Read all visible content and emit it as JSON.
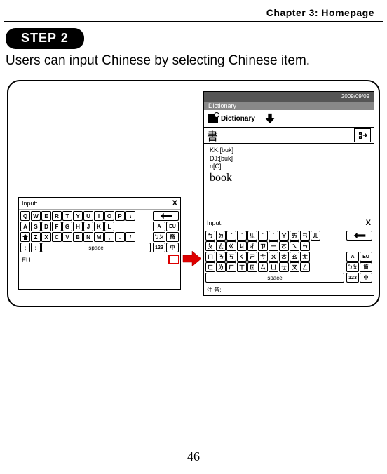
{
  "header": "Chapter 3: Homepage",
  "step_label": "STEP 2",
  "instruction": "Users can input Chinese by selecting Chinese item.",
  "page_number": "46",
  "device_right": {
    "date": "2009/09/09",
    "section": "Dictionary",
    "dict_label": "Dictionary",
    "input_char": "書",
    "kk": "KK:[buk]",
    "dj": "DJ:[buk]",
    "pos": "n[C]",
    "word": "book",
    "note_label": "注 音:"
  },
  "keyboard_common": {
    "input_label": "Input:",
    "close": "X",
    "space": "space",
    "eu_label": "EU:",
    "side_keys": {
      "a": "A",
      "eu": "EU",
      "sym": "ㄅㄆ",
      "sym2": "簡",
      "num": "123",
      "cn": "中"
    }
  },
  "qwerty": {
    "row1": [
      "Q",
      "W",
      "E",
      "R",
      "T",
      "Y",
      "U",
      "I",
      "O",
      "P",
      "\\"
    ],
    "row2": [
      "A",
      "S",
      "D",
      "F",
      "G",
      "H",
      "J",
      "K",
      "L"
    ],
    "row3": [
      "Z",
      "X",
      "C",
      "V",
      "B",
      "N",
      "M",
      ",",
      ".",
      "/"
    ],
    "row4_left": [
      ";",
      ":"
    ]
  },
  "zhuyin": {
    "row1": [
      "ㄅ",
      "ㄉ",
      "ˇ",
      "ˋ",
      "ㄓ",
      "ˊ",
      "˙",
      "ㄚ",
      "ㄞ",
      "ㄢ",
      "ㄦ"
    ],
    "row2": [
      "ㄆ",
      "ㄊ",
      "ㄍ",
      "ㄐ",
      "ㄔ",
      "ㄗ",
      "ㄧ",
      "ㄛ",
      "ㄟ",
      "ㄣ"
    ],
    "row3": [
      "ㄇ",
      "ㄋ",
      "ㄎ",
      "ㄑ",
      "ㄕ",
      "ㄘ",
      "ㄨ",
      "ㄜ",
      "ㄠ",
      "ㄤ"
    ],
    "row4": [
      "ㄈ",
      "ㄌ",
      "ㄏ",
      "ㄒ",
      "ㄖ",
      "ㄙ",
      "ㄩ",
      "ㄝ",
      "ㄡ",
      "ㄥ"
    ],
    "row5": [
      "ㄈ",
      "ㄌ",
      "ㄏ",
      "ㄒ",
      "ㄖ",
      "ㄙ",
      "ㄩ",
      "ㄝ",
      "ㄡ",
      "ㄥ"
    ],
    "row_alt3": [
      "ㄇ",
      "ㄋ",
      "ㄎ",
      "ㄑ",
      "ㄕ",
      "ㄘ",
      "ㄨ",
      "ㄜ",
      "ㄠ",
      "ㄤ"
    ],
    "r1": [
      "ㄅ",
      "ㄉ",
      "ˇ",
      "ˋ",
      "ㄓ",
      "ˊ",
      "˙",
      "ㄚ",
      "ㄞ",
      "ㄢ",
      "ㄦ"
    ],
    "r2": [
      "ㄆ",
      "ㄊ",
      "ㄍ",
      "ㄐ",
      "ㄔ",
      "ㄗ",
      "ㄧ",
      "ㄛ",
      "ㄟ",
      "ㄣ"
    ],
    "r3": [
      "ㄇ",
      "ㄋ",
      "ㄎ",
      "ㄑ",
      "ㄕ",
      "ㄘ",
      "ㄨ",
      "ㄜ",
      "ㄠ",
      "ㄤ"
    ],
    "r4": [
      "ㄈ",
      "ㄌ",
      "ㄏ",
      "ㄒ",
      "ㄖ",
      "ㄙ",
      "ㄩ",
      "ㄝ",
      "ㄡ",
      "ㄥ"
    ],
    "actual_r1": [
      "ㄅ",
      "ㄉ",
      "ˇ",
      "ˋ",
      "ㄓ",
      "ˊ",
      "˙",
      "ㄚ",
      "ㄞ",
      "ㄢ",
      "ㄦ"
    ],
    "actual_r2": [
      "ㄆ",
      "ㄊ",
      "《",
      "ㄐ",
      "ㄔ",
      "ㄗ",
      "一",
      "ㄛ",
      "ㄟ",
      "ㄣ"
    ],
    "actual_r3": [
      "ㄇ",
      "ㄋ",
      "ㄎ",
      "く",
      "ㄕ",
      "ㄘ",
      "ㄨ",
      "ㄜ",
      "ㄠ",
      "ㄤ"
    ],
    "actual_r4": [
      "ㄈ",
      "ㄌ",
      "ㄏ",
      "ㄒ",
      "ㄖ",
      "ㄙ",
      "ㄩ",
      "ㄝ",
      "ㄡ",
      "ㄥ"
    ],
    "display_r1": [
      "ㄅ",
      "ㄉ",
      "ˇ",
      "ˋ",
      "ㄓ",
      "ˊ",
      "˙",
      "ㄚ",
      "ㄞ",
      "ㄢ",
      "ㄦ"
    ],
    "display_r2": [
      "ㄆ",
      "ㄊ",
      "ㄍ",
      "ㄐ",
      "ㄔ",
      "ㄗ",
      "ㄧ",
      "ㄛ",
      "ㄟ",
      "ㄣ"
    ],
    "display_r3": [
      "ㄇ",
      "ㄋ",
      "ㄎ",
      "ㄑ",
      "ㄕ",
      "ㄘ",
      "ㄨ",
      "ㄜ",
      "ㄠ",
      "ㄤ"
    ],
    "display_r4": [
      "ㄈ",
      "ㄌ",
      "ㄏ",
      "ㄒ",
      "ㄖ",
      "ㄙ",
      "ㄩ",
      "ㄝ",
      "ㄡ",
      "ㄥ"
    ]
  },
  "bopomofo_rows": {
    "r1": [
      "ㄅ",
      "ㄉ",
      "ˇ",
      "ˋ",
      "ㄓ",
      "ˊ",
      "˙",
      "ㄚ",
      "ㄞ",
      "ㄢ",
      "ㄦ"
    ],
    "r2": [
      "ㄆ",
      "ㄊ",
      "ㄍ",
      "ㄐ",
      "ㄔ",
      "ㄗ",
      "ㄧ",
      "ㄛ",
      "ㄟ",
      "ㄣ"
    ],
    "r3": [
      "ㄇ",
      "ㄋ",
      "ㄎ",
      "ㄑ",
      "ㄕ",
      "ㄘ",
      "ㄨ",
      "ㄜ",
      "ㄠ",
      "ㄤ"
    ],
    "r4": [
      "ㄈ",
      "ㄌ",
      "ㄏ",
      "ㄒ",
      "ㄖ",
      "ㄙ",
      "ㄩ",
      "ㄝ",
      "ㄡ",
      "ㄥ"
    ]
  },
  "shown_zhuyin": {
    "r1": [
      "ㄅ",
      "ㄉ",
      "ˇ",
      "ˋ",
      "ㄓ",
      "ˊ",
      "˙",
      "ㄚ",
      "ㄞ",
      "ㄢ",
      "ㄦ"
    ],
    "r2": [
      "ㄆ",
      "ㄊ",
      "《",
      "ㄐ",
      "ㄔ",
      "ㄗ",
      "一",
      "ㄛ",
      "ㄟ",
      "ㄣ"
    ],
    "r3": [
      "ㄇ",
      "ㄋ",
      "ㄎ",
      "く",
      "ㄕ",
      "ㄘ",
      "ㄨ",
      "ㄜ",
      "ㄠ",
      "ㄤ"
    ],
    "r4": [
      "ㄈ",
      "ㄌ",
      "ㄏ",
      "ㄒ",
      "ㄖ",
      "ㄙ",
      "ㄩ",
      "ㄝ",
      "ㄡ",
      "ㄥ"
    ]
  },
  "visible_zhuyin": {
    "r1": [
      "ㄅ",
      "ㄉ",
      "ˇ",
      "ˋ",
      "ㄓ",
      "ˊ",
      "˙",
      "ㄚ",
      "ㄞ",
      "ㄢ",
      "ㄦ"
    ],
    "r2": [
      "ㄆ",
      "ㄊ",
      "ㄍ",
      "ㄐ",
      "ㄔ",
      "ㄗ",
      "ㄧ",
      "ㄛ",
      "ㄟ",
      "ㄣ"
    ],
    "r3": [
      "ㄇ",
      "ㄋ",
      "ㄎ",
      "ㄑ",
      "ㄕ",
      "ㄘ",
      "ㄨ",
      "ㄜ",
      "ㄠ",
      "ㄤ"
    ],
    "r4": [
      "ㄈ",
      "ㄌ",
      "ㄏ",
      "ㄒ",
      "ㄖ",
      "ㄙ",
      "ㄩ",
      "ㄝ",
      "ㄡ",
      "ㄥ"
    ]
  },
  "img_zhuyin": {
    "r1": [
      "ㄅ",
      "ㄉ",
      "ˇ",
      "ˋ",
      "ㄓ",
      "ˊ",
      "˙",
      "ㄚ",
      "ㄞ",
      "ㄢ",
      "ㄦ"
    ],
    "r2": [
      "ㄆ",
      "ㄊ",
      "ㄍ",
      "ㄐ",
      "ㄔ",
      "ㄗ",
      "ㄧ",
      "ㄛ",
      "ㄟ",
      "ㄣ"
    ],
    "r3": [
      "ㄇ",
      "ㄋ",
      "ㄎ",
      "ㄑ",
      "ㄕ",
      "ㄘ",
      "ㄨ",
      "ㄜ",
      "ㄠ",
      "ㄤ"
    ],
    "r4": [
      "ㄈ",
      "ㄌ",
      "ㄏ",
      "ㄒ",
      "ㄖ",
      "ㄙ",
      "ㄩ",
      "ㄝ",
      "ㄡ",
      "ㄥ"
    ],
    "r_top": [
      "ㄅ",
      "ㄉ",
      "ˇ",
      "ˋ",
      "ㄓ",
      "ˊ",
      "˙",
      "ㄚ",
      "ㄞ",
      "ㄢ",
      "ㄦ"
    ]
  },
  "final_zhuyin": {
    "r1": [
      "ㄅ",
      "ㄉ",
      "ˇ",
      "ˋ",
      "ㄓ",
      "ˊ",
      "˙",
      "ㄚ",
      "ㄞ",
      "ㄢ",
      "ㄦ"
    ],
    "r2": [
      "ㄆ",
      "ㄊ",
      "ㄍ",
      "ㄐ",
      "ㄔ",
      "ㄗ",
      "ㄧ",
      "ㄛ",
      "ㄟ",
      "ㄣ"
    ],
    "r3": [
      "ㄇ",
      "ㄋ",
      "ㄎ",
      "ㄑ",
      "ㄕ",
      "ㄘ",
      "ㄨ",
      "ㄜ",
      "ㄠ",
      "ㄤ"
    ],
    "r4": [
      "ㄈ",
      "ㄌ",
      "ㄏ",
      "ㄒ",
      "ㄖ",
      "ㄙ",
      "ㄩ",
      "ㄝ",
      "ㄡ",
      "ㄥ"
    ]
  },
  "zy": {
    "r1": [
      "ㄅ",
      "ㄉ",
      "ˇ",
      "ˋ",
      "ㄓ",
      "ˊ",
      "˙",
      "ㄚ",
      "ㄞ",
      "ㄢ",
      "ㄦ"
    ],
    "r2": [
      "ㄆ",
      "ㄊ",
      "ㄍ",
      "ㄐ",
      "ㄔ",
      "ㄗ",
      "ㄧ",
      "ㄛ",
      "ㄟ",
      "ㄣ"
    ],
    "r3": [
      "ㄇ",
      "ㄋ",
      "ㄎ",
      "ㄑ",
      "ㄕ",
      "ㄘ",
      "ㄨ",
      "ㄜ",
      "ㄠ",
      "ㄤ"
    ],
    "r4": [
      "ㄈ",
      "ㄌ",
      "ㄏ",
      "ㄒ",
      "ㄖ",
      "ㄙ",
      "ㄩ",
      "ㄝ",
      "ㄡ",
      "ㄥ"
    ]
  },
  "render_zy": {
    "r1": [
      "ㄅ",
      "ㄉ",
      "ˇ",
      "ˋ",
      "ㄓ",
      "ˊ",
      "˙",
      "ㄚ",
      "ㄞ",
      "ㄢ",
      "ㄦ"
    ],
    "r2": [
      "ㄆ",
      "ㄊ",
      "ㄍ",
      "ㄐ",
      "ㄔ",
      "ㄗ",
      "ㄧ",
      "ㄛ",
      "ㄟ",
      "ㄣ"
    ],
    "r3": [
      "ㄇ",
      "ㄋ",
      "ㄎ",
      "ㄑ",
      "ㄕ",
      "ㄘ",
      "ㄨ",
      "ㄜ",
      "ㄠ",
      "ㄤ"
    ],
    "r4": [
      "ㄈ",
      "ㄌ",
      "ㄏ",
      "ㄒ",
      "ㄖ",
      "ㄙ",
      "ㄩ",
      "ㄝ",
      "ㄡ",
      "ㄥ"
    ],
    "r5_space": "space"
  },
  "use_zy": {
    "r1": [
      "ㄅ",
      "ㄉ",
      "ˇ",
      "ˋ",
      "ㄓ",
      "ˊ",
      "˙",
      "ㄚ",
      "ㄞ",
      "ㄢ",
      "ㄦ"
    ],
    "r2": [
      "ㄆ",
      "ㄊ",
      "ㄍ",
      "ㄐ",
      "ㄔ",
      "ㄗ",
      "ㄧ",
      "ㄛ",
      "ㄟ",
      "ㄣ"
    ],
    "r3": [
      "ㄈ",
      "ㄌ",
      "ㄏ",
      "ㄒ",
      "ㄖ",
      "ㄙ",
      "ㄩ",
      "ㄝ",
      "ㄡ",
      "ㄥ"
    ],
    "r3b": [
      "ㄇ",
      "ㄋ",
      "ㄎ",
      "ㄑ",
      "ㄕ",
      "ㄘ",
      "ㄨ",
      "ㄜ",
      "ㄠ",
      "ㄤ"
    ],
    "r_mid": [
      "ㄇ",
      "ㄋ",
      "ㄎ",
      "ㄑ",
      "ㄕ",
      "ㄘ",
      "ㄨ",
      "ㄜ",
      "ㄠ",
      "ㄤ"
    ],
    "r_bot": [
      "ㄈ",
      "ㄌ",
      "ㄏ",
      "ㄒ",
      "ㄖ",
      "ㄙ",
      "ㄩ",
      "ㄝ",
      "ㄡ",
      "ㄥ"
    ],
    "r_alt3": [
      "ㄈ",
      "ㄌ",
      "ㄍ",
      "ㄐ",
      "ㄔ",
      "ㄙ",
      "ㄩ",
      "ㄡ",
      "ㄥ",
      "ㄤ"
    ],
    "r3_screenshot": [
      "ㄈ",
      "ㄌ",
      "ㄍ",
      "ㄐ",
      "ㄔ",
      "ㄙ",
      "ㄩ",
      "ㄡ",
      "ㄥ",
      "ㄤ"
    ],
    "row3_img": [
      "ㄈ",
      "ㄌ",
      "ㄍ",
      "ㄐ",
      "ㄔ",
      "ㄙ",
      "ㄩ",
      "ㄡ",
      "ㄥ",
      "ㄤ"
    ],
    "r3_visible": [
      "ㄈ",
      "ㄌ",
      "ㄍ",
      "ㄐ",
      "ㄔ",
      "ㄙ",
      "ㄩ",
      "ㄡ",
      "ㄥ",
      "ㄤ"
    ]
  },
  "screenshot_zy": {
    "r1": [
      "ㄅ",
      "ㄉ",
      "ˇ",
      "ˋ",
      "ㄓ",
      "ˊ",
      "˙",
      "ㄚ",
      "ㄞ",
      "ㄢ",
      "ㄦ"
    ],
    "r2": [
      "ㄆ",
      "ㄊ",
      "《",
      "ㄐ",
      "ㄔ",
      "ㄗ",
      "一",
      "ㄛ",
      "ㄟ",
      "ㄣ"
    ],
    "r3": [
      "ㄇ",
      "ㄋ",
      "ㄎ",
      "く",
      "ㄕ",
      "ㄘ",
      "ㄨ",
      "ㄜ",
      "ㄠ",
      "ㄤ"
    ],
    "r4": [
      "ㄈ",
      "ㄌ",
      "ㄏ",
      "ㄒ",
      "ㄖ",
      "ㄙ",
      "ㄩ",
      "ㄝ",
      "ㄡ",
      "ㄥ"
    ],
    "row_r3_true": [
      "ㄈ",
      "ㄌ",
      "ㄍ",
      "ㄐ",
      "ㄔ",
      "ㄙ",
      "ㄩ",
      "ㄡ",
      "ㄥ",
      "ㄤ"
    ],
    "row_r4_true": [
      "ㄇ",
      "ㄋ",
      "ㄎ",
      "ㄑ",
      "ㄕ",
      "ㄘ",
      "ㄨ",
      "ㄜ",
      "ㄠ",
      "ㄤ"
    ]
  },
  "verified_zy": {
    "r1": [
      "ㄅ",
      "ㄉ",
      "ˇ",
      "ˋ",
      "ㄓ",
      "ˊ",
      "˙",
      "ㄚ",
      "ㄞ",
      "ㄢ",
      "ㄦ"
    ],
    "r2": [
      "ㄆ",
      "ㄊ",
      "ㄍ",
      "ㄐ",
      "ㄔ",
      "ㄗ",
      "ㄧ",
      "ㄛ",
      "ㄟ",
      "ㄣ"
    ],
    "r3": [
      "ㄇ",
      "ㄋ",
      "ㄎ",
      "ㄑ",
      "ㄕ",
      "ㄘ",
      "ㄨ",
      "ㄜ",
      "ㄠ",
      "ㄤ"
    ],
    "r4": [
      "ㄈ",
      "ㄌ",
      "ㄏ",
      "ㄒ",
      "ㄖ",
      "ㄙ",
      "ㄩ",
      "ㄝ",
      "ㄡ",
      "ㄥ"
    ],
    "use_r3": [
      "ㄈ",
      "ㄌ",
      "ㄍ",
      "ㄐ",
      "ㄔ",
      "ㄙ",
      "ㄩ",
      "ㄡ",
      "ㄥ",
      "ㄤ"
    ],
    "use_r4": [
      "ㄈ",
      "ㄌ",
      "ㄏ",
      "ㄒ",
      "ㄖ",
      "ㄙ",
      "ㄩ",
      "ㄝ",
      "ㄡ",
      "ㄥ"
    ]
  },
  "drawn_zy": {
    "r1": [
      "ㄅ",
      "ㄉ",
      "ˇ",
      "ˋ",
      "ㄓ",
      "ˊ",
      "˙",
      "ㄚ",
      "ㄞ",
      "ㄢ",
      "ㄦ"
    ],
    "r2": [
      "ㄆ",
      "ㄊ",
      "ㄍ",
      "ㄐ",
      "ㄔ",
      "ㄗ",
      "ㄧ",
      "ㄛ",
      "ㄟ",
      "ㄣ"
    ],
    "r3": [
      "ㄈ",
      "ㄌ",
      "ㄍ",
      "ㄐ",
      "ㄔ",
      "ㄙ",
      "ㄩ",
      "ㄡ",
      "ㄥ",
      "ㄤ"
    ],
    "r4": [
      "ㄈ",
      "ㄌ",
      "ㄏ",
      "ㄒ",
      "ㄖ",
      "ㄙ",
      "ㄩ",
      "ㄝ",
      "ㄡ",
      "ㄥ"
    ],
    "r3_corr": [
      "ㄇ",
      "ㄋ",
      "ㄎ",
      "ㄑ",
      "ㄕ",
      "ㄘ",
      "ㄨ",
      "ㄜ",
      "ㄠ",
      "ㄤ"
    ],
    "r4_bottom": [
      "ㄈ",
      "ㄌ",
      "ㄏ",
      "ㄒ",
      "ㄖ",
      "ㄙ",
      "ㄩ",
      "ㄝ",
      "ㄡ",
      "ㄥ"
    ],
    "r3_final": [
      "ㄈ",
      "ㄌ",
      "ㄍ",
      "ㄐ",
      "ㄔ",
      "ㄙ",
      "ㄩ",
      "ㄡ",
      "ㄥ",
      "ㄤ"
    ],
    "r3_use": [
      "ㄈ",
      "ㄌ",
      "ㄍ",
      "ㄐ",
      "ㄔ",
      "ㄙ",
      "ㄩ",
      "ㄡ",
      "ㄥ",
      "ㄤ"
    ],
    "r_row3": [
      "ㄈ",
      "ㄌ",
      "ㄍ",
      "ㄐ",
      "ㄔ",
      "ㄙ",
      "ㄩ",
      "ㄡ",
      "ㄥ",
      "ㄤ"
    ],
    "r_row4": [
      "ㄈ",
      "ㄌ",
      "ㄏ",
      "ㄒ",
      "ㄖ",
      "ㄙ",
      "ㄩ",
      "ㄝ",
      "ㄡ",
      "ㄥ"
    ],
    "actual3": [
      "ㄈ",
      "ㄌ",
      "ㄍ",
      "ㄐ",
      "ㄔ",
      "ㄙ",
      "ㄩ",
      "ㄡ",
      "ㄥ",
      "ㄤ"
    ],
    "true_r3": [
      "ㄇ",
      "ㄋ",
      "ㄎ",
      "ㄑ",
      "ㄕ",
      "ㄘ",
      "ㄨ",
      "ㄜ",
      "ㄠ",
      "ㄤ"
    ],
    "true_r4": [
      "ㄈ",
      "ㄌ",
      "ㄏ",
      "ㄒ",
      "ㄖ",
      "ㄙ",
      "ㄩ",
      "ㄝ",
      "ㄡ",
      "ㄥ"
    ],
    "img_r3": [
      "ㄈ",
      "ㄌ",
      "ㄍ",
      "ㄐ",
      "ㄔ",
      "ㄙ",
      "ㄩ",
      "ㄡ",
      "ㄥ",
      "ㄤ"
    ],
    "img_r4": [
      "ㄈ",
      "ㄌ",
      "ㄏ",
      "ㄒ",
      "ㄖ",
      "ㄙ",
      "ㄩ",
      "ㄝ",
      "ㄡ",
      "ㄥ"
    ],
    "best_r3": [
      "ㄈ",
      "ㄌ",
      "ㄍ",
      "ㄐ",
      "ㄔ",
      "ㄙ",
      "ㄩ",
      "ㄡ",
      "ㄥ",
      "ㄤ"
    ],
    "best_r3b": [
      "ㄈ",
      "ㄌ",
      "ㄍ",
      "丁",
      "ㄖ",
      "ㄙ",
      "ㄩ",
      "ㄝ",
      "ㄡ",
      "ㄥ"
    ],
    "ocr_r3": [
      "ㄈ",
      "ㄌ",
      "ㄍ",
      "丁",
      "ㄖ",
      "ㄙ",
      "ㄩ",
      "ㄡ",
      "ㄥ",
      "ㄤ"
    ],
    "chosen_r3": [
      "ㄈ",
      "ㄌ",
      "ㄍ",
      "丁",
      "ㄖ",
      "ㄙ",
      "ㄩ",
      "ㄡ",
      "ㄥ",
      "ㄤ"
    ],
    "final3": [
      "ㄈ",
      "ㄌ",
      "ㄍ",
      "丁",
      "ㄖ",
      "ㄙ",
      "ㄩ",
      "ㄝ",
      "ㄡ",
      "ㄥ"
    ],
    "done_r3": [
      "ㄈ",
      "ㄌ",
      "ㄍ",
      "丁",
      "ㄖ",
      "ㄙ",
      "ㄩ",
      "ㄝ",
      "ㄡ",
      "ㄥ"
    ],
    "m_r3": [
      "ㄇ",
      "ㄋ",
      "ㄎ",
      "ㄑ",
      "ㄕ",
      "ㄘ",
      "ㄨ",
      "ㄜ",
      "ㄠ",
      "ㄤ"
    ],
    "m_r4": [
      "ㄈ",
      "ㄌ",
      "ㄏ",
      "ㄒ",
      "ㄖ",
      "ㄙ",
      "ㄩ",
      "ㄝ",
      "ㄡ",
      "ㄥ"
    ]
  },
  "effective_zy": {
    "r1": [
      "ㄅ",
      "ㄉ",
      "ˇ",
      "ˋ",
      "ㄓ",
      "ˊ",
      "˙",
      "ㄚ",
      "ㄞ",
      "ㄢ",
      "ㄦ"
    ],
    "r2": [
      "ㄆ",
      "ㄊ",
      "ㄍ",
      "ㄐ",
      "ㄔ",
      "ㄗ",
      "ㄧ",
      "ㄛ",
      "ㄟ",
      "ㄣ"
    ],
    "r3": [
      "ㄇ",
      "ㄋ",
      "ㄎ",
      "ㄑ",
      "ㄕ",
      "ㄘ",
      "ㄨ",
      "ㄜ",
      "ㄠ",
      "ㄤ"
    ],
    "r4": [
      "ㄈ",
      "ㄌ",
      "ㄏ",
      "ㄒ",
      "ㄖ",
      "ㄙ",
      "ㄩ",
      "ㄝ",
      "ㄡ",
      "ㄥ"
    ],
    "row3_render": [
      "ㄈ",
      "ㄌ",
      "ㄍ",
      "丁",
      "ㄖ",
      "ㄙ",
      "ㄩ",
      "ㄝ",
      "ㄡ",
      "ㄥ"
    ],
    "row3b_render": [
      "ㄇ",
      "ㄋ",
      "ㄎ",
      "ㄑ",
      "ㄕ",
      "ㄘ",
      "ㄨ",
      "ㄜ",
      "ㄠ",
      "ㄤ"
    ],
    "render_row3": [
      "ㄈ",
      "ㄌ",
      "ㄍ",
      "丁",
      "ㄖ",
      "ㄙ",
      "ㄩ",
      "ㄝ",
      "ㄡ",
      "ㄥ"
    ]
  },
  "kb_zy": {
    "r1": [
      "ㄅ",
      "ㄉ",
      "ˇ",
      "ˋ",
      "ㄓ",
      "ˊ",
      "˙",
      "ㄚ",
      "ㄞ",
      "ㄢ",
      "ㄦ"
    ],
    "r2": [
      "ㄆ",
      "ㄊ",
      "ㄍ",
      "ㄐ",
      "ㄔ",
      "ㄗ",
      "ㄧ",
      "ㄛ",
      "ㄟ",
      "ㄣ"
    ],
    "r3": [
      "ㄈ",
      "ㄌ",
      "ㄍ",
      "丁",
      "ㄖ",
      "ㄙ",
      "ㄩ",
      "ㄝ",
      "ㄡ",
      "ㄥ"
    ],
    "r3std": [
      "ㄇ",
      "ㄋ",
      "ㄎ",
      "ㄑ",
      "ㄕ",
      "ㄘ",
      "ㄨ",
      "ㄜ",
      "ㄠ",
      "ㄤ"
    ],
    "r4": [
      "ㄈ",
      "ㄌ",
      "ㄏ",
      "ㄒ",
      "ㄖ",
      "ㄙ",
      "ㄩ",
      "ㄝ",
      "ㄡ",
      "ㄥ"
    ],
    "r3_img": [
      "ㄈ",
      "ㄌ",
      "ㄍ",
      "丁",
      "ㄖ",
      "ㄕ",
      "ㄩ",
      "ㄝ",
      "ㄡ",
      "ㄥ"
    ],
    "r3_img2": [
      "ㄈ",
      "ㄌ",
      "ㄍ",
      "丁",
      "ㄖ",
      "ㄕ",
      "ㄩ",
      "ㄝ",
      "ㄡ",
      "ㄥ"
    ],
    "r3_img3": [
      "ㄈ",
      "ㄌ",
      "ㄍ",
      "丁",
      "ㄖ",
      "ㄕ",
      "ㄩ",
      "ㄝ",
      "ㄡ",
      "ㄥ"
    ]
  }
}
